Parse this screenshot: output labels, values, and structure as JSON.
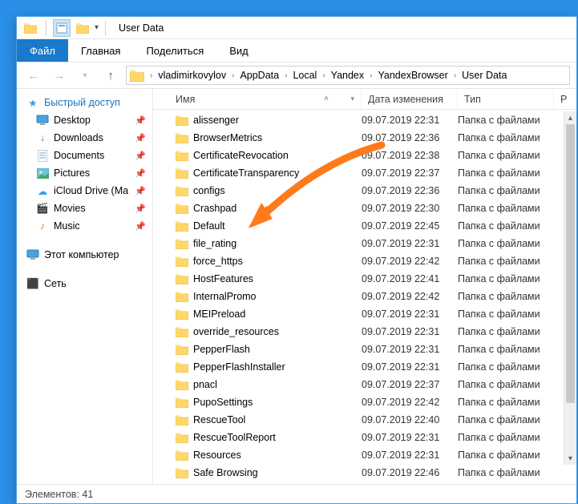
{
  "title": "User Data",
  "menu": {
    "file": "Файл",
    "home": "Главная",
    "share": "Поделиться",
    "view": "Вид"
  },
  "breadcrumb": [
    "vladimirkovylov",
    "AppData",
    "Local",
    "Yandex",
    "YandexBrowser",
    "User Data"
  ],
  "columns": {
    "name": "Имя",
    "modified": "Дата изменения",
    "type": "Тип",
    "last": "Р"
  },
  "sidebar": {
    "quick": "Быстрый доступ",
    "items": [
      {
        "label": "Desktop",
        "icon": "desktop"
      },
      {
        "label": "Downloads",
        "icon": "download"
      },
      {
        "label": "Documents",
        "icon": "document"
      },
      {
        "label": "Pictures",
        "icon": "pictures"
      },
      {
        "label": "iCloud Drive (Ma",
        "icon": "icloud"
      },
      {
        "label": "Movies",
        "icon": "movies"
      },
      {
        "label": "Music",
        "icon": "music"
      }
    ],
    "thispc": "Этот компьютер",
    "network": "Сеть"
  },
  "files": [
    {
      "name": "alissenger",
      "date": "09.07.2019 22:31",
      "type": "Папка с файлами"
    },
    {
      "name": "BrowserMetrics",
      "date": "09.07.2019 22:36",
      "type": "Папка с файлами"
    },
    {
      "name": "CertificateRevocation",
      "date": "09.07.2019 22:38",
      "type": "Папка с файлами"
    },
    {
      "name": "CertificateTransparency",
      "date": "09.07.2019 22:37",
      "type": "Папка с файлами"
    },
    {
      "name": "configs",
      "date": "09.07.2019 22:36",
      "type": "Папка с файлами"
    },
    {
      "name": "Crashpad",
      "date": "09.07.2019 22:30",
      "type": "Папка с файлами"
    },
    {
      "name": "Default",
      "date": "09.07.2019 22:45",
      "type": "Папка с файлами"
    },
    {
      "name": "file_rating",
      "date": "09.07.2019 22:31",
      "type": "Папка с файлами"
    },
    {
      "name": "force_https",
      "date": "09.07.2019 22:42",
      "type": "Папка с файлами"
    },
    {
      "name": "HostFeatures",
      "date": "09.07.2019 22:41",
      "type": "Папка с файлами"
    },
    {
      "name": "InternalPromo",
      "date": "09.07.2019 22:42",
      "type": "Папка с файлами"
    },
    {
      "name": "MEIPreload",
      "date": "09.07.2019 22:31",
      "type": "Папка с файлами"
    },
    {
      "name": "override_resources",
      "date": "09.07.2019 22:31",
      "type": "Папка с файлами"
    },
    {
      "name": "PepperFlash",
      "date": "09.07.2019 22:31",
      "type": "Папка с файлами"
    },
    {
      "name": "PepperFlashInstaller",
      "date": "09.07.2019 22:31",
      "type": "Папка с файлами"
    },
    {
      "name": "pnacl",
      "date": "09.07.2019 22:37",
      "type": "Папка с файлами"
    },
    {
      "name": "PupoSettings",
      "date": "09.07.2019 22:42",
      "type": "Папка с файлами"
    },
    {
      "name": "RescueTool",
      "date": "09.07.2019 22:40",
      "type": "Папка с файлами"
    },
    {
      "name": "RescueToolReport",
      "date": "09.07.2019 22:31",
      "type": "Папка с файлами"
    },
    {
      "name": "Resources",
      "date": "09.07.2019 22:31",
      "type": "Папка с файлами"
    },
    {
      "name": "Safe Browsing",
      "date": "09.07.2019 22:46",
      "type": "Папка с файлами"
    }
  ],
  "status": {
    "count_label": "Элементов:",
    "count": "41"
  }
}
